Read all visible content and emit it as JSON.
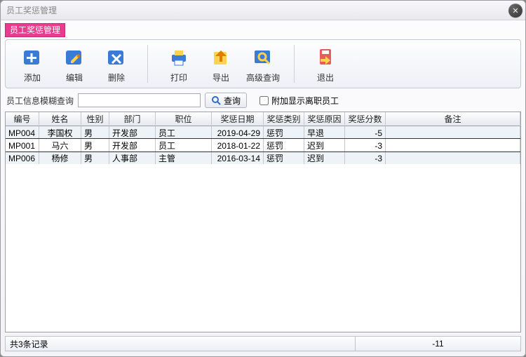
{
  "window": {
    "title": "员工奖惩管理"
  },
  "header_tag": "员工奖惩管理",
  "toolbar": {
    "add": "添加",
    "edit": "编辑",
    "del": "删除",
    "print": "打印",
    "export": "导出",
    "advq": "高级查询",
    "exit": "退出"
  },
  "search": {
    "label": "员工信息模糊查询",
    "value": "",
    "query_btn": "查询",
    "show_left_label": "附加显示离职员工",
    "show_left_checked": false
  },
  "columns": {
    "id": "编号",
    "name": "姓名",
    "sex": "性别",
    "dept": "部门",
    "pos": "职位",
    "date": "奖惩日期",
    "type": "奖惩类别",
    "reason": "奖惩原因",
    "score": "奖惩分数",
    "note": "备注"
  },
  "rows": [
    {
      "id": "MP004",
      "name": "李国权",
      "sex": "男",
      "dept": "开发部",
      "pos": "员工",
      "date": "2019-04-29",
      "type": "惩罚",
      "reason": "早退",
      "score": "-5",
      "note": ""
    },
    {
      "id": "MP001",
      "name": "马六",
      "sex": "男",
      "dept": "开发部",
      "pos": "员工",
      "date": "2018-01-22",
      "type": "惩罚",
      "reason": "迟到",
      "score": "-3",
      "note": ""
    },
    {
      "id": "MP006",
      "name": "杨修",
      "sex": "男",
      "dept": "人事部",
      "pos": "主管",
      "date": "2016-03-14",
      "type": "惩罚",
      "reason": "迟到",
      "score": "-3",
      "note": ""
    }
  ],
  "status": {
    "count_text": "共3条记录",
    "sum_text": "-11"
  },
  "icons": {
    "add": "add-icon",
    "edit": "edit-icon",
    "del": "delete-icon",
    "print": "print-icon",
    "export": "export-icon",
    "advq": "search-advanced-icon",
    "exit": "exit-icon",
    "mag": "search-icon",
    "close": "close-icon"
  }
}
